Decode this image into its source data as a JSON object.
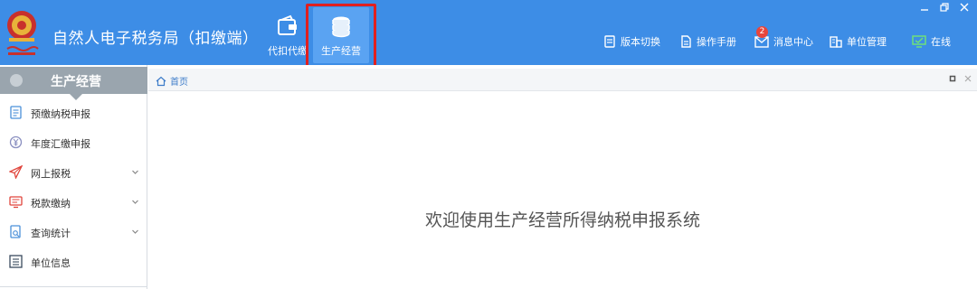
{
  "header": {
    "app_title": "自然人电子税务局（扣缴端）",
    "tabs": [
      {
        "label": "代扣代缴",
        "icon": "wallet-icon"
      },
      {
        "label": "生产经营",
        "icon": "coin-stack-icon",
        "active": true
      }
    ],
    "right_menu": [
      {
        "label": "版本切换",
        "icon": "version-switch-icon"
      },
      {
        "label": "操作手册",
        "icon": "manual-icon"
      },
      {
        "label": "消息中心",
        "icon": "mail-icon",
        "badge": "2"
      },
      {
        "label": "单位管理",
        "icon": "building-icon"
      },
      {
        "label": "在线",
        "icon": "monitor-icon"
      }
    ]
  },
  "sidebar": {
    "title": "生产经营",
    "items": [
      {
        "label": "预缴纳税申报",
        "icon": "form-icon",
        "expandable": false
      },
      {
        "label": "年度汇缴申报",
        "icon": "yuan-icon",
        "expandable": false
      },
      {
        "label": "网上报税",
        "icon": "send-icon",
        "expandable": true
      },
      {
        "label": "税款缴纳",
        "icon": "payment-monitor-icon",
        "expandable": true
      },
      {
        "label": "查询统计",
        "icon": "search-doc-icon",
        "expandable": true
      },
      {
        "label": "单位信息",
        "icon": "list-icon",
        "expandable": false
      }
    ]
  },
  "main": {
    "home_tab": "首页",
    "welcome": "欢迎使用生产经营所得纳税申报系统"
  },
  "colors": {
    "header_bg": "#3d8de6",
    "active_tab_bg": "#5aa3f2",
    "highlight_border": "#e02020",
    "sidebar_head": "#9aa5ae"
  }
}
